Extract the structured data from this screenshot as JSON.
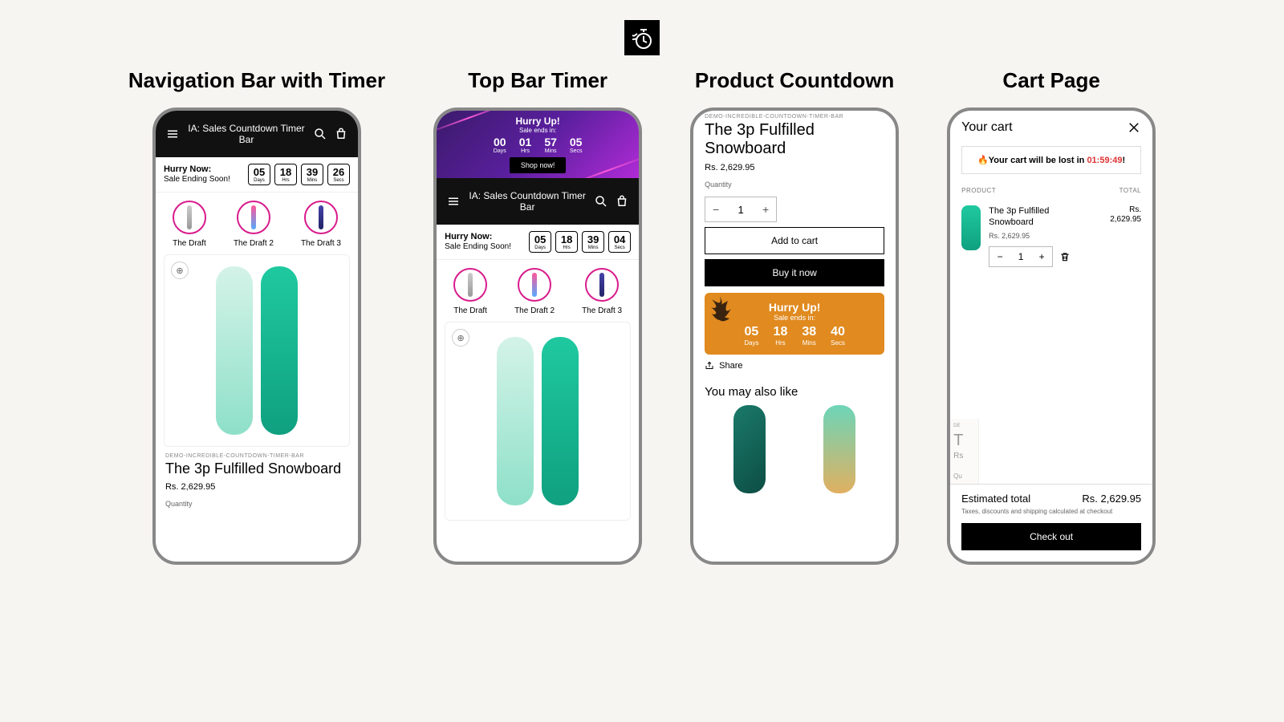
{
  "hero_icon": "stopwatch-icon",
  "columns": {
    "nav": {
      "title": "Navigation Bar with Timer",
      "header_title": "IA: Sales Countdown Timer Bar",
      "timer_label_1": "Hurry Now:",
      "timer_label_2": "Sale Ending Soon!",
      "timer": {
        "days": "05",
        "hrs": "18",
        "mins": "39",
        "secs": "26"
      },
      "units": {
        "days": "Days",
        "hrs": "Hrs",
        "mins": "Mins",
        "secs": "Secs"
      },
      "drafts": [
        "The Draft",
        "The Draft 2",
        "The Draft 3"
      ],
      "vendor": "DEMO-INCREDIBLE-COUNTDOWN-TIMER-BAR",
      "product_title": "The 3p Fulfilled Snowboard",
      "price": "Rs. 2,629.95",
      "qty_label": "Quantity"
    },
    "top": {
      "title": "Top Bar  Timer",
      "banner_heading": "Hurry Up!",
      "banner_sub": "Sale ends in:",
      "banner_timer": {
        "days": "00",
        "hrs": "01",
        "mins": "57",
        "secs": "05"
      },
      "units": {
        "days": "Days",
        "hrs": "Hrs",
        "mins": "Mins",
        "secs": "Secs"
      },
      "banner_cta": "Shop now!",
      "header_title": "IA: Sales Countdown Timer Bar",
      "timer_label_1": "Hurry Now:",
      "timer_label_2": "Sale Ending Soon!",
      "timer": {
        "days": "05",
        "hrs": "18",
        "mins": "39",
        "secs": "04"
      },
      "drafts": [
        "The Draft",
        "The Draft 2",
        "The Draft 3"
      ]
    },
    "product": {
      "title": "Product Countdown",
      "vendor": "DEMO-INCREDIBLE-COUNTDOWN-TIMER-BAR",
      "product_title": "The 3p Fulfilled Snowboard",
      "price": "Rs. 2,629.95",
      "qty_label": "Quantity",
      "qty_value": "1",
      "add_to_cart": "Add to cart",
      "buy_now": "Buy it now",
      "banner_heading": "Hurry Up!",
      "banner_sub": "Sale ends in:",
      "banner_timer": {
        "days": "05",
        "hrs": "18",
        "mins": "38",
        "secs": "40"
      },
      "units": {
        "days": "Days",
        "hrs": "Hrs",
        "mins": "Mins",
        "secs": "Secs"
      },
      "share": "Share",
      "yml": "You may also like"
    },
    "cart": {
      "title": "Cart Page",
      "heading": "Your cart",
      "warn_pre": "🔥Your cart will be lost in ",
      "warn_time": "01:59:49",
      "warn_post": "!",
      "col_product": "PRODUCT",
      "col_total": "TOTAL",
      "item_name": "The 3p Fulfilled Snowboard",
      "item_unit_price": "Rs. 2,629.95",
      "item_total_pre": "Rs.",
      "item_total": "2,629.95",
      "qty_value": "1",
      "ghost_vendor": "DE",
      "ghost_title": "T",
      "ghost_price": "Rs",
      "ghost_qty": "Qu",
      "est_label": "Estimated total",
      "est_value": "Rs. 2,629.95",
      "tax_note": "Taxes, discounts and shipping calculated at checkout",
      "checkout": "Check out"
    }
  }
}
